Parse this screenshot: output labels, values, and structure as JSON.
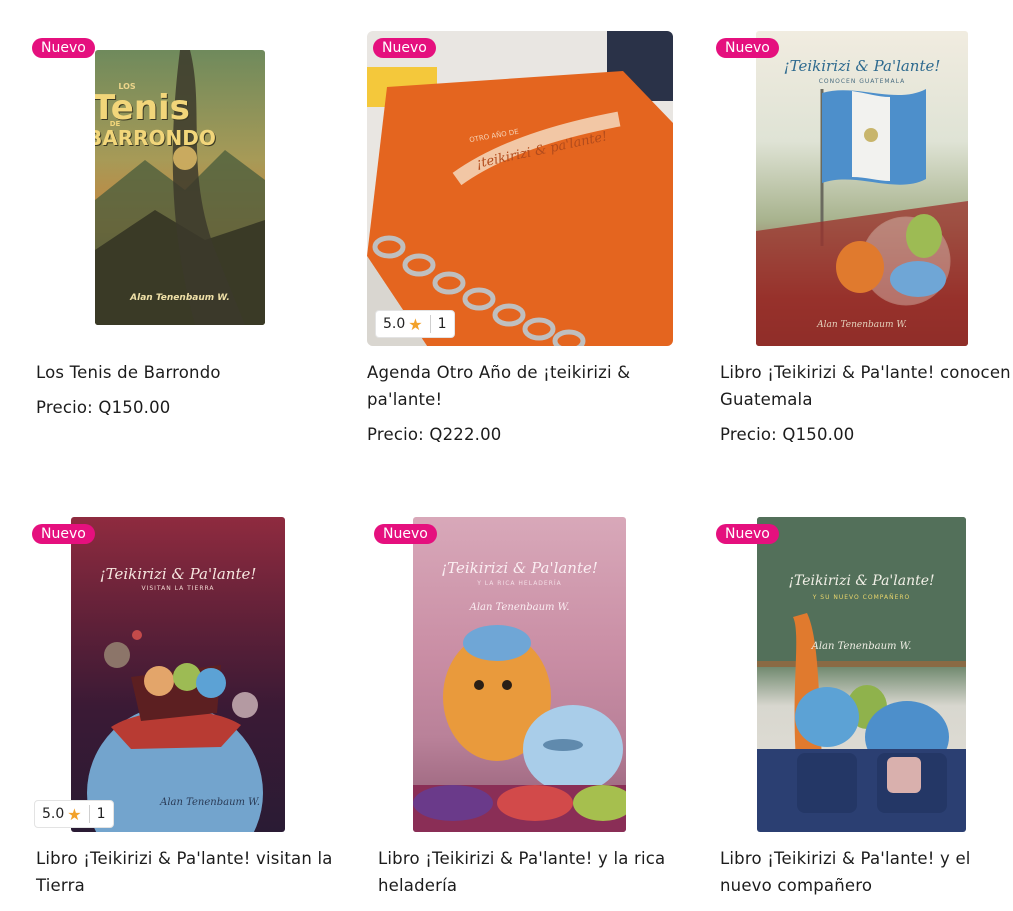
{
  "products": [
    {
      "title": "Los Tenis de Barrondo",
      "price": "Precio: Q150.00",
      "badge": "Nuevo",
      "cover": {
        "top": "LOS",
        "big1": "Tenis",
        "de": "DE",
        "big2": "BARRONDO",
        "author": "Alan Tenenbaum W."
      }
    },
    {
      "title": "Agenda Otro Año de ¡teikirizi & pa'lante!",
      "price": "Precio: Q222.00",
      "badge": "Nuevo",
      "rating": {
        "score": "5.0",
        "count": "1"
      },
      "cover": {
        "small": "OTRO AÑO DE",
        "script": "¡teikirizi & pa'lante!"
      }
    },
    {
      "title": "Libro ¡Teikirizi & Pa'lante! conocen Guatemala",
      "price": "Precio: Q150.00",
      "badge": "Nuevo",
      "cover": {
        "script": "¡Teikirizi & Pa'lante!",
        "sub": "CONOCEN GUATEMALA",
        "author": "Alan Tenenbaum W."
      }
    },
    {
      "title": "Libro ¡Teikirizi & Pa'lante! visitan la Tierra",
      "badge": "Nuevo",
      "rating": {
        "score": "5.0",
        "count": "1"
      },
      "cover": {
        "script": "¡Teikirizi & Pa'lante!",
        "sub": "VISITAN LA TIERRA",
        "author": "Alan Tenenbaum W."
      }
    },
    {
      "title": "Libro ¡Teikirizi & Pa'lante! y la rica heladería",
      "badge": "Nuevo",
      "cover": {
        "script": "¡Teikirizi & Pa'lante!",
        "sub": "Y LA RICA HELADERÍA",
        "author": "Alan Tenenbaum W."
      }
    },
    {
      "title": "Libro ¡Teikirizi & Pa'lante! y el nuevo compañero",
      "badge": "Nuevo",
      "cover": {
        "script": "¡Teikirizi & Pa'lante!",
        "sub": "Y SU NUEVO COMPAÑERO",
        "author": "Alan Tenenbaum W."
      }
    }
  ]
}
